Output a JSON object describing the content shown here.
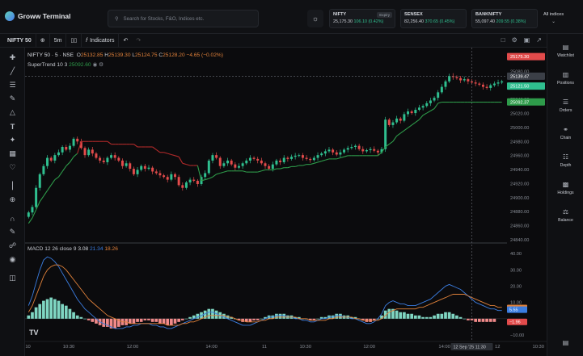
{
  "header": {
    "app_title": "Groww Terminal",
    "search_placeholder": "Search for Stocks, F&O, Indices etc.",
    "indices": [
      {
        "name": "NIFTY",
        "value": "25,175.30",
        "change": "106.10 (0.42%)",
        "badge": "Expiry"
      },
      {
        "name": "SENSEX",
        "value": "82,256.40",
        "change": "370.65 (0.45%)",
        "badge": ""
      },
      {
        "name": "BANKNIFTY",
        "value": "55,097.40",
        "change": "209.55 (0.38%)",
        "badge": ""
      }
    ],
    "all_indices": "All indices"
  },
  "toolbar": {
    "symbol": "NIFTY 50",
    "interval": "5m",
    "indicators": "Indicators"
  },
  "legend": {
    "title": "NIFTY 50 · 5 · NSE",
    "o_label": "O",
    "o": "25132.85",
    "h_label": "H",
    "h": "25139.30",
    "l_label": "L",
    "l": "25124.75",
    "c_label": "C",
    "c": "25128.20",
    "chg": "−4.65 (−0.02%)",
    "supertrend_label": "SuperTrend 10 3",
    "supertrend_val": "25092.60",
    "macd_label": "MACD 12 26 close 9",
    "macd_hist": "3.08",
    "macd_line": "21.34",
    "macd_signal": "18.26"
  },
  "sidebar": {
    "items": [
      {
        "label": "Watchlist",
        "icon": "watchlist-icon"
      },
      {
        "label": "Positions",
        "icon": "positions-icon"
      },
      {
        "label": "Orders",
        "icon": "orders-icon"
      },
      {
        "label": "Chain",
        "icon": "chain-icon"
      },
      {
        "label": "Depth",
        "icon": "depth-icon"
      },
      {
        "label": "Holdings",
        "icon": "holdings-icon"
      },
      {
        "label": "Balance",
        "icon": "balance-icon"
      }
    ]
  },
  "colors": {
    "up": "#2fbf8f",
    "down": "#e24b4b",
    "supertrend_up": "#2e9b4a",
    "supertrend_down": "#b22a2a",
    "macd_line": "#3b7de0",
    "signal_line": "#e0813a",
    "hist_up": "#7fd6c2",
    "hist_down": "#f08a8a"
  },
  "chart_data": {
    "type": "candlestick",
    "price_axis": {
      "min": 24840,
      "max": 25180,
      "ticks": [
        "25160.00",
        "25080.00",
        "25060.00",
        "25040.00",
        "25020.00",
        "25000.00",
        "24980.00",
        "24960.00",
        "24940.00",
        "24920.00",
        "24900.00",
        "24880.00",
        "24860.00",
        "24840.00"
      ]
    },
    "price_labels": [
      {
        "text": "25175.30",
        "value": 25175.3,
        "color": "#e24b4b"
      },
      {
        "text": "25139.47",
        "value": 25139.47,
        "color": "#3b3f47"
      },
      {
        "text": "25121.50",
        "value": 25121.5,
        "color": "#2fbf8f"
      },
      {
        "text": "25092.37",
        "value": 25092.37,
        "color": "#2e9b4a"
      }
    ],
    "macd_axis": {
      "min": -12,
      "max": 45,
      "ticks": [
        "40.00",
        "30.00",
        "20.00",
        "10.00",
        "−10.00"
      ],
      "labels": [
        {
          "text": "6.61",
          "value": 6.61,
          "color": "#e0813a"
        },
        {
          "text": "5.55",
          "value": 5.55,
          "color": "#3b7de0"
        },
        {
          "text": "−1.96",
          "value": -1.96,
          "color": "#e24b4b"
        }
      ]
    },
    "time_axis": {
      "labels": [
        {
          "text": "10",
          "bar": 0
        },
        {
          "text": "10:30",
          "bar": 10
        },
        {
          "text": "12:00",
          "bar": 27
        },
        {
          "text": "14:00",
          "bar": 48
        },
        {
          "text": "11",
          "bar": 63
        },
        {
          "text": "10:30",
          "bar": 73
        },
        {
          "text": "12:00",
          "bar": 90
        },
        {
          "text": "14:00",
          "bar": 110
        },
        {
          "text": "12",
          "bar": 125
        },
        {
          "text": "10:30",
          "bar": 135
        }
      ],
      "crosshair_label": "12 Sep '25  11:30"
    },
    "close": [
      24890,
      24900,
      24935,
      24960,
      24975,
      24990,
      24985,
      24995,
      25000,
      25010,
      25005,
      25012,
      25025,
      25020,
      25008,
      24995,
      25005,
      24998,
      24990,
      24985,
      24982,
      24990,
      24995,
      24990,
      24985,
      24975,
      24980,
      24970,
      24960,
      24968,
      24975,
      24970,
      24972,
      24965,
      24962,
      24958,
      24955,
      24950,
      24960,
      24955,
      24940,
      24935,
      24945,
      24950,
      24948,
      24942,
      24955,
      24962,
      24985,
      24995,
      24990,
      24975,
      24980,
      24985,
      24978,
      24972,
      24975,
      24980,
      24985,
      24990,
      24988,
      24985,
      24980,
      24975,
      24970,
      24978,
      24985,
      24982,
      24990,
      24988,
      24992,
      24994,
      24995,
      24990,
      24988,
      24986,
      24990,
      24995,
      24998,
      25002,
      25005,
      25000,
      24996,
      25000,
      25005,
      25008,
      25010,
      25012,
      25006,
      25002,
      25004,
      25006,
      25003,
      25000,
      25006,
      25060,
      25050,
      25055,
      25062,
      25058,
      25070,
      25075,
      25072,
      25078,
      25082,
      25085,
      25090,
      25095,
      25100,
      25110,
      25120,
      25130,
      25140,
      25138,
      25136,
      25132,
      25134,
      25130,
      25128,
      25126,
      25124,
      25120,
      25118,
      25123,
      25126,
      25128,
      25130
    ],
    "supertrend": [
      24870,
      24880,
      24895,
      24910,
      24920,
      24930,
      24940,
      24950,
      24955,
      24965,
      24975,
      24982,
      24992,
      24998,
      25020,
      25020,
      25020,
      25020,
      25020,
      25020,
      25020,
      25020,
      25015,
      25015,
      25015,
      25015,
      25015,
      25015,
      25015,
      25010,
      25010,
      25010,
      25010,
      25010,
      25005,
      25000,
      25000,
      24998,
      24996,
      24994,
      24992,
      24980,
      24978,
      24976,
      24976,
      24976,
      24948,
      24950,
      24952,
      24955,
      24960,
      24962,
      24964,
      24966,
      24966,
      24966,
      24966,
      24966,
      24964,
      24964,
      24964,
      24964,
      24966,
      24968,
      24968,
      24968,
      24970,
      24970,
      24972,
      24972,
      24974,
      24974,
      24976,
      24976,
      24978,
      24978,
      24980,
      24982,
      24984,
      24986,
      24988,
      24988,
      24988,
      24990,
      24992,
      24994,
      24994,
      24994,
      24994,
      24994,
      24994,
      24994,
      24994,
      24994,
      25000,
      25010,
      25015,
      25020,
      25030,
      25035,
      25040,
      25045,
      25050,
      25055,
      25060,
      25068,
      25072,
      25076,
      25080,
      25090,
      25092,
      25092,
      25092,
      25092,
      25092,
      25092,
      25092,
      25092,
      25092,
      25092,
      25092,
      25092,
      25092,
      25092,
      25092,
      25092,
      25092
    ],
    "macd_hist": [
      2,
      4,
      7,
      9,
      11,
      12,
      13,
      12,
      11,
      9,
      8,
      6,
      4,
      2,
      1,
      0,
      -1,
      -2,
      -3,
      -4,
      -5,
      -5,
      -6,
      -6,
      -5,
      -4,
      -4,
      -3,
      -3,
      -2,
      -2,
      -1,
      -1,
      -2,
      -2,
      -3,
      -3,
      -4,
      -4,
      -3,
      -2,
      -1,
      0,
      1,
      2,
      3,
      4,
      5,
      6,
      6,
      5,
      4,
      3,
      2,
      1,
      0,
      -1,
      -2,
      -2,
      -2,
      -1,
      -1,
      0,
      1,
      2,
      2,
      3,
      3,
      3,
      2,
      2,
      1,
      1,
      0,
      0,
      -1,
      -1,
      0,
      1,
      1,
      2,
      2,
      3,
      3,
      2,
      2,
      1,
      1,
      0,
      -1,
      -2,
      -2,
      -1,
      0,
      2,
      5,
      6,
      6,
      5,
      4,
      4,
      3,
      3,
      2,
      2,
      1,
      1,
      1,
      2,
      3,
      3,
      4,
      4,
      3,
      2,
      1,
      0,
      -1,
      -1,
      -2,
      -2,
      -2,
      -2,
      -2,
      -2
    ],
    "macd_line": [
      8,
      14,
      22,
      30,
      36,
      38,
      37,
      35,
      32,
      28,
      24,
      20,
      16,
      12,
      9,
      6,
      4,
      2,
      0,
      -2,
      -3,
      -4,
      -5,
      -6,
      -6,
      -6,
      -5,
      -5,
      -4,
      -4,
      -3,
      -3,
      -3,
      -4,
      -4,
      -5,
      -5,
      -6,
      -6,
      -5,
      -4,
      -3,
      -2,
      -1,
      0,
      1,
      2,
      3,
      4,
      4,
      3,
      2,
      1,
      0,
      -1,
      -2,
      -3,
      -4,
      -4,
      -4,
      -3,
      -2,
      -1,
      0,
      1,
      1,
      2,
      2,
      2,
      1,
      1,
      0,
      0,
      -1,
      -1,
      -2,
      -2,
      -1,
      0,
      0,
      1,
      1,
      2,
      2,
      1,
      1,
      0,
      0,
      -1,
      -2,
      -3,
      -3,
      -2,
      0,
      3,
      8,
      10,
      11,
      10,
      9,
      9,
      8,
      8,
      8,
      9,
      10,
      11,
      12,
      14,
      16,
      18,
      20,
      21,
      20,
      19,
      18,
      16,
      14,
      12,
      10,
      9,
      8,
      7,
      6,
      6,
      5,
      5
    ],
    "signal_line": [
      4,
      8,
      14,
      20,
      26,
      30,
      32,
      33,
      33,
      32,
      30,
      27,
      24,
      21,
      18,
      15,
      12,
      10,
      8,
      6,
      4,
      2,
      1,
      0,
      -1,
      -2,
      -2,
      -3,
      -3,
      -3,
      -3,
      -3,
      -3,
      -3,
      -3,
      -3,
      -3,
      -4,
      -4,
      -4,
      -4,
      -3,
      -3,
      -2,
      -2,
      -1,
      0,
      1,
      2,
      2,
      2,
      2,
      2,
      1,
      1,
      0,
      -1,
      -1,
      -2,
      -2,
      -2,
      -2,
      -1,
      -1,
      0,
      0,
      1,
      1,
      1,
      1,
      1,
      1,
      0,
      0,
      0,
      -1,
      -1,
      -1,
      -1,
      -1,
      0,
      0,
      1,
      1,
      1,
      1,
      1,
      0,
      0,
      -1,
      -1,
      -1,
      -1,
      -1,
      0,
      2,
      4,
      5,
      6,
      6,
      6,
      6,
      6,
      6,
      7,
      7,
      8,
      9,
      10,
      11,
      12,
      13,
      14,
      15,
      15,
      15,
      15,
      14,
      13,
      12,
      11,
      10,
      9,
      8,
      8,
      7,
      7
    ]
  }
}
